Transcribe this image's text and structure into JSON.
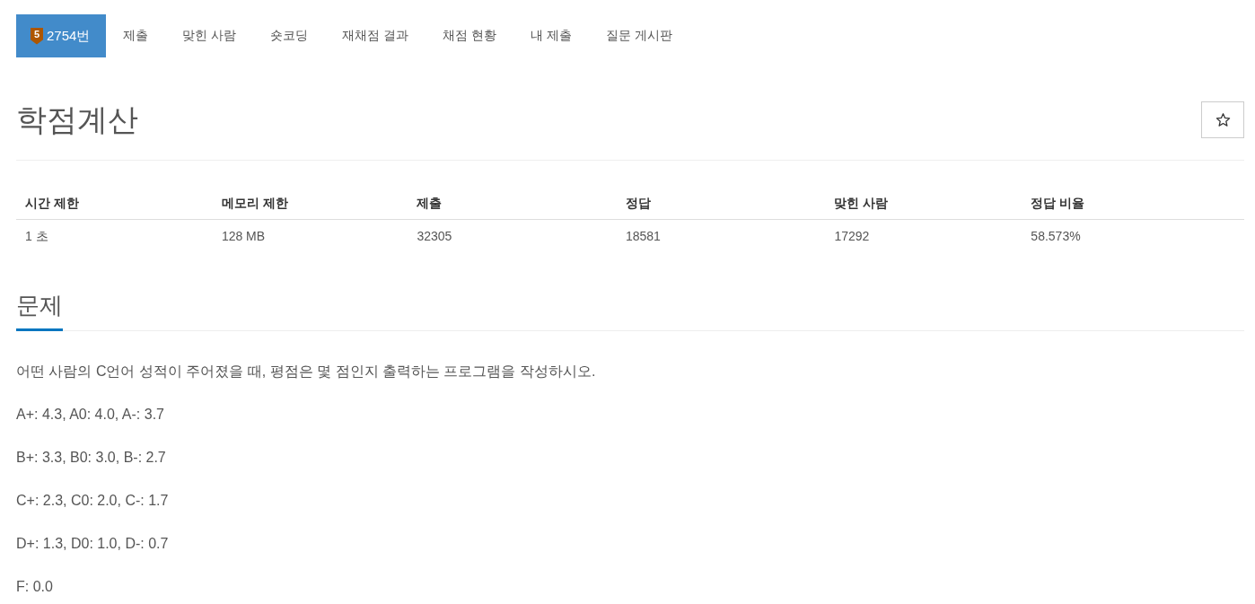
{
  "nav": {
    "tabs": [
      {
        "label": "2754번",
        "selected": true,
        "badge": "5"
      },
      {
        "label": "제출",
        "selected": false
      },
      {
        "label": "맞힌 사람",
        "selected": false
      },
      {
        "label": "숏코딩",
        "selected": false
      },
      {
        "label": "재채점 결과",
        "selected": false
      },
      {
        "label": "채점 현황",
        "selected": false
      },
      {
        "label": "내 제출",
        "selected": false
      },
      {
        "label": "질문 게시판",
        "selected": false
      }
    ]
  },
  "problem": {
    "title": "학점계산",
    "starred": false
  },
  "stats": {
    "columns": [
      "시간 제한",
      "메모리 제한",
      "제출",
      "정답",
      "맞힌 사람",
      "정답 비율"
    ],
    "rows": [
      [
        "1 초",
        "128 MB",
        "32305",
        "18581",
        "17292",
        "58.573%"
      ]
    ]
  },
  "section": {
    "heading": "문제",
    "paragraphs": [
      "어떤 사람의 C언어 성적이 주어졌을 때, 평점은 몇 점인지 출력하는 프로그램을 작성하시오.",
      "A+: 4.3, A0: 4.0, A-: 3.7",
      "B+: 3.3, B0: 3.0, B-: 2.7",
      "C+: 2.3, C0: 2.0, C-: 1.7",
      "D+: 1.3, D0: 1.0, D-: 0.7",
      "F: 0.0"
    ]
  }
}
